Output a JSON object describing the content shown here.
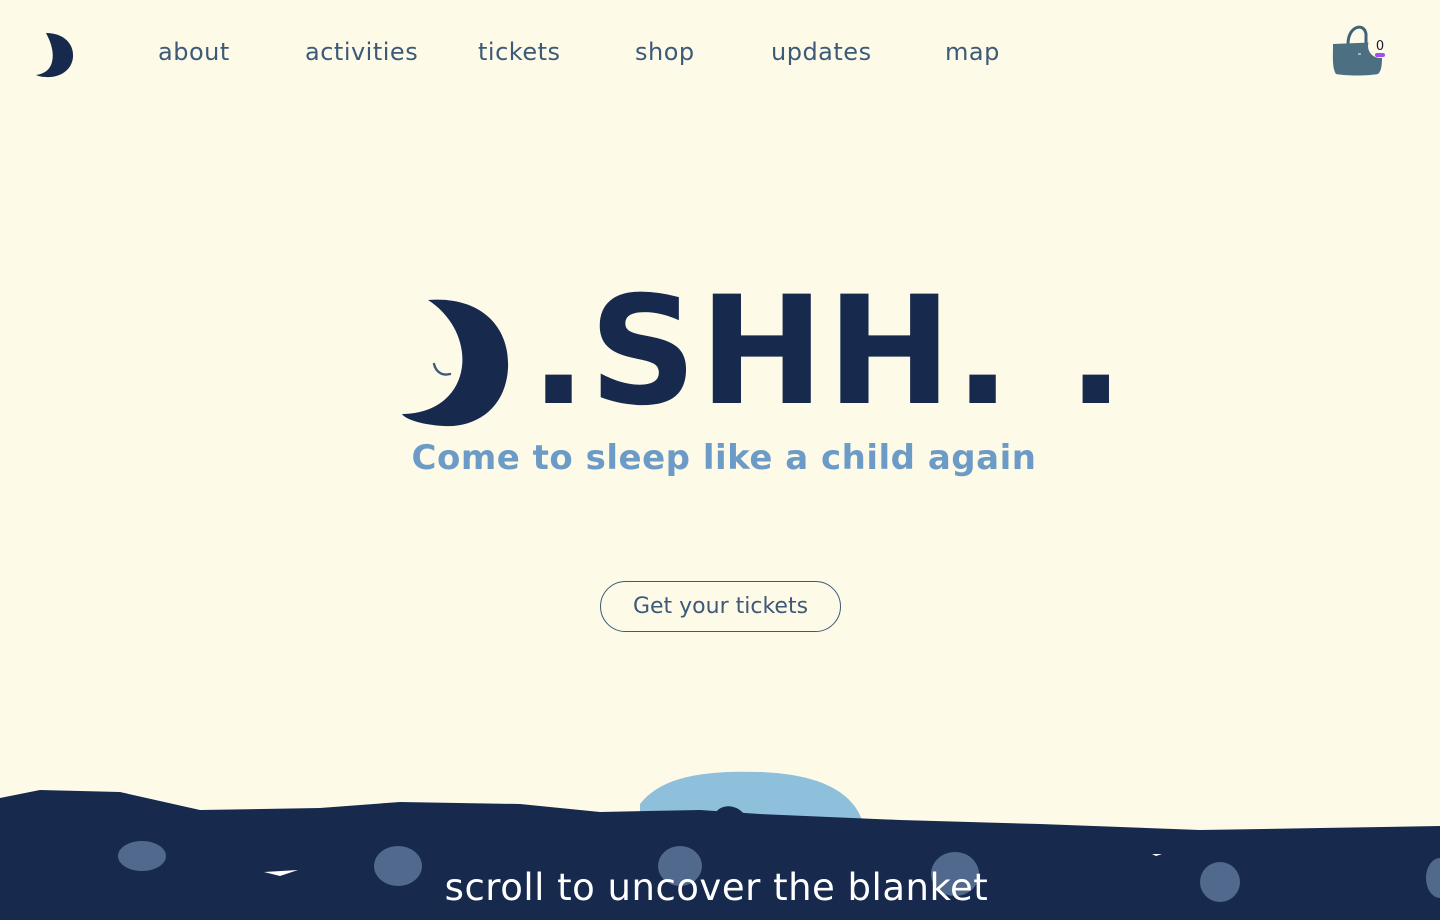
{
  "nav": {
    "logo_icon": "crescent-moon-icon",
    "links": [
      {
        "label": "about"
      },
      {
        "label": "activities"
      },
      {
        "label": "tickets"
      },
      {
        "label": "shop"
      },
      {
        "label": "updates"
      },
      {
        "label": "map"
      }
    ]
  },
  "cart": {
    "icon": "shopping-basket-icon",
    "count": "0"
  },
  "hero": {
    "logo_icon": "sleeping-moon-icon",
    "title": ".SHH. .",
    "tagline": "Come to sleep like a child again",
    "cta_label": "Get your tickets"
  },
  "footer": {
    "scroll_hint": "scroll to uncover the blanket"
  },
  "colors": {
    "background": "#fefae8",
    "navy": "#172a4e",
    "nav_text": "#3d5a78",
    "tagline": "#6b9bc6",
    "badge_accent": "#a34cf0",
    "peeking_head": "#8ebfdb"
  }
}
